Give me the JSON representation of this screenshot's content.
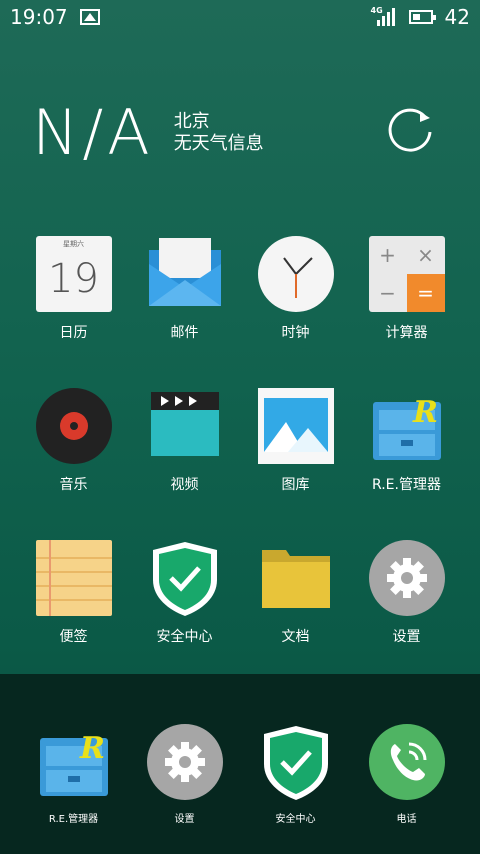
{
  "status_bar": {
    "time": "19:07",
    "network": "4G",
    "battery": "42"
  },
  "weather": {
    "temp": "N/A",
    "city": "北京",
    "desc": "无天气信息"
  },
  "apps_row1": [
    {
      "label": "日历",
      "icon": "calendar-icon",
      "cal_header": "星期六",
      "cal_day": "19"
    },
    {
      "label": "邮件",
      "icon": "mail-icon"
    },
    {
      "label": "时钟",
      "icon": "clock-icon"
    },
    {
      "label": "计算器",
      "icon": "calculator-icon"
    }
  ],
  "apps_row2": [
    {
      "label": "音乐",
      "icon": "music-icon"
    },
    {
      "label": "视频",
      "icon": "video-icon"
    },
    {
      "label": "图库",
      "icon": "gallery-icon"
    },
    {
      "label": "R.E.管理器",
      "icon": "re-manager-icon"
    }
  ],
  "apps_row3": [
    {
      "label": "便签",
      "icon": "notes-icon"
    },
    {
      "label": "安全中心",
      "icon": "security-icon"
    },
    {
      "label": "文档",
      "icon": "folder-icon"
    },
    {
      "label": "设置",
      "icon": "settings-icon"
    }
  ],
  "dock": [
    {
      "label": "R.E.管理器",
      "icon": "re-manager-icon"
    },
    {
      "label": "设置",
      "icon": "settings-icon"
    },
    {
      "label": "安全中心",
      "icon": "security-icon"
    },
    {
      "label": "电话",
      "icon": "phone-icon"
    }
  ],
  "colors": {
    "background": "#12634f",
    "dock": "#06271f",
    "shield": "#18a86b",
    "calc_accent": "#f18a2c",
    "phone": "#4fb463"
  }
}
